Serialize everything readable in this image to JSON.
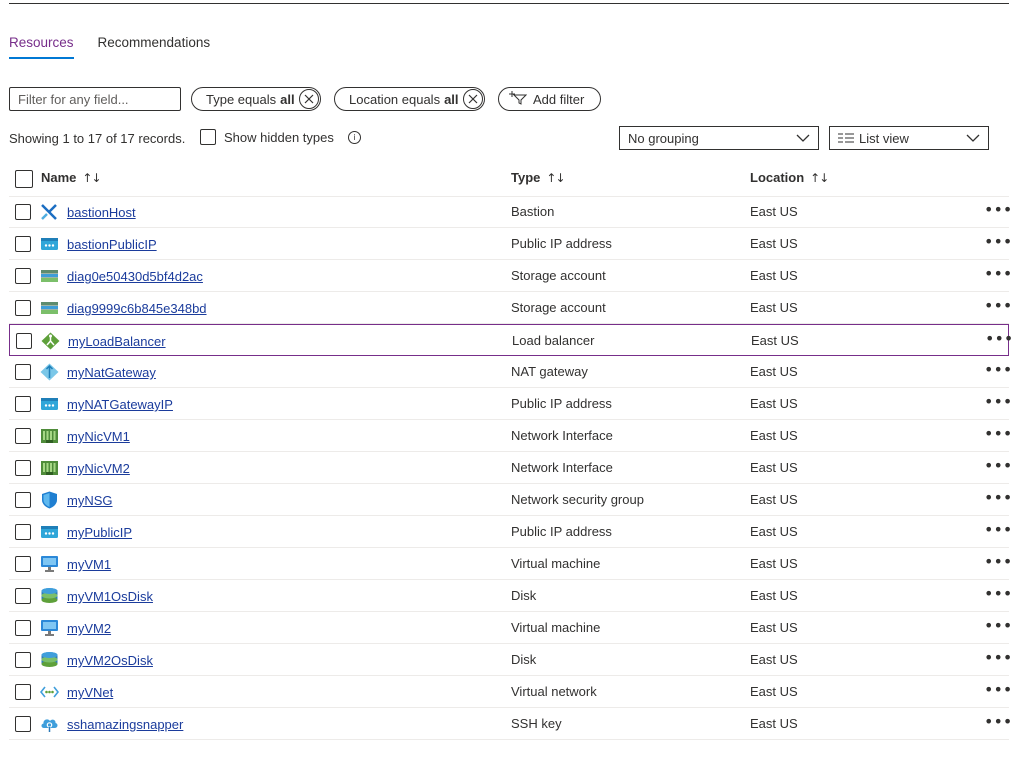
{
  "tabs": [
    {
      "label": "Resources",
      "active": true
    },
    {
      "label": "Recommendations",
      "active": false
    }
  ],
  "filters": {
    "placeholder": "Filter for any field...",
    "type_pill": {
      "prefix": "Type equals",
      "value": "all"
    },
    "location_pill": {
      "prefix": "Location equals",
      "value": "all"
    },
    "add_filter": "Add filter"
  },
  "records_text": "Showing 1 to 17 of 17 records.",
  "show_hidden_label": "Show hidden types",
  "grouping": "No grouping",
  "view": "List view",
  "columns": {
    "name": "Name",
    "type": "Type",
    "location": "Location"
  },
  "sort_glyph": "↑↓",
  "more_glyph": "•••",
  "colors": {
    "accent": "#772e8a",
    "link": "#1b3c9c",
    "tab_underline": "#0078d4"
  },
  "rows": [
    {
      "name": "bastionHost",
      "type": "Bastion",
      "location": "East US",
      "icon": "bastion-icon"
    },
    {
      "name": "bastionPublicIP",
      "type": "Public IP address",
      "location": "East US",
      "icon": "public-ip-icon"
    },
    {
      "name": "diag0e50430d5bf4d2ac",
      "type": "Storage account",
      "location": "East US",
      "icon": "storage-account-icon"
    },
    {
      "name": "diag9999c6b845e348bd",
      "type": "Storage account",
      "location": "East US",
      "icon": "storage-account-icon"
    },
    {
      "name": "myLoadBalancer",
      "type": "Load balancer",
      "location": "East US",
      "icon": "load-balancer-icon",
      "selected": true
    },
    {
      "name": "myNatGateway",
      "type": "NAT gateway",
      "location": "East US",
      "icon": "nat-gateway-icon"
    },
    {
      "name": "myNATGatewayIP",
      "type": "Public IP address",
      "location": "East US",
      "icon": "public-ip-icon"
    },
    {
      "name": "myNicVM1",
      "type": "Network Interface",
      "location": "East US",
      "icon": "network-interface-icon"
    },
    {
      "name": "myNicVM2",
      "type": "Network Interface",
      "location": "East US",
      "icon": "network-interface-icon"
    },
    {
      "name": "myNSG",
      "type": "Network security group",
      "location": "East US",
      "icon": "network-security-group-icon"
    },
    {
      "name": "myPublicIP",
      "type": "Public IP address",
      "location": "East US",
      "icon": "public-ip-icon"
    },
    {
      "name": "myVM1",
      "type": "Virtual machine",
      "location": "East US",
      "icon": "virtual-machine-icon"
    },
    {
      "name": "myVM1OsDisk",
      "type": "Disk",
      "location": "East US",
      "icon": "disk-icon"
    },
    {
      "name": "myVM2",
      "type": "Virtual machine",
      "location": "East US",
      "icon": "virtual-machine-icon"
    },
    {
      "name": "myVM2OsDisk",
      "type": "Disk",
      "location": "East US",
      "icon": "disk-icon"
    },
    {
      "name": "myVNet",
      "type": "Virtual network",
      "location": "East US",
      "icon": "virtual-network-icon"
    },
    {
      "name": "sshamazingsnapper",
      "type": "SSH key",
      "location": "East US",
      "icon": "ssh-key-icon"
    }
  ]
}
